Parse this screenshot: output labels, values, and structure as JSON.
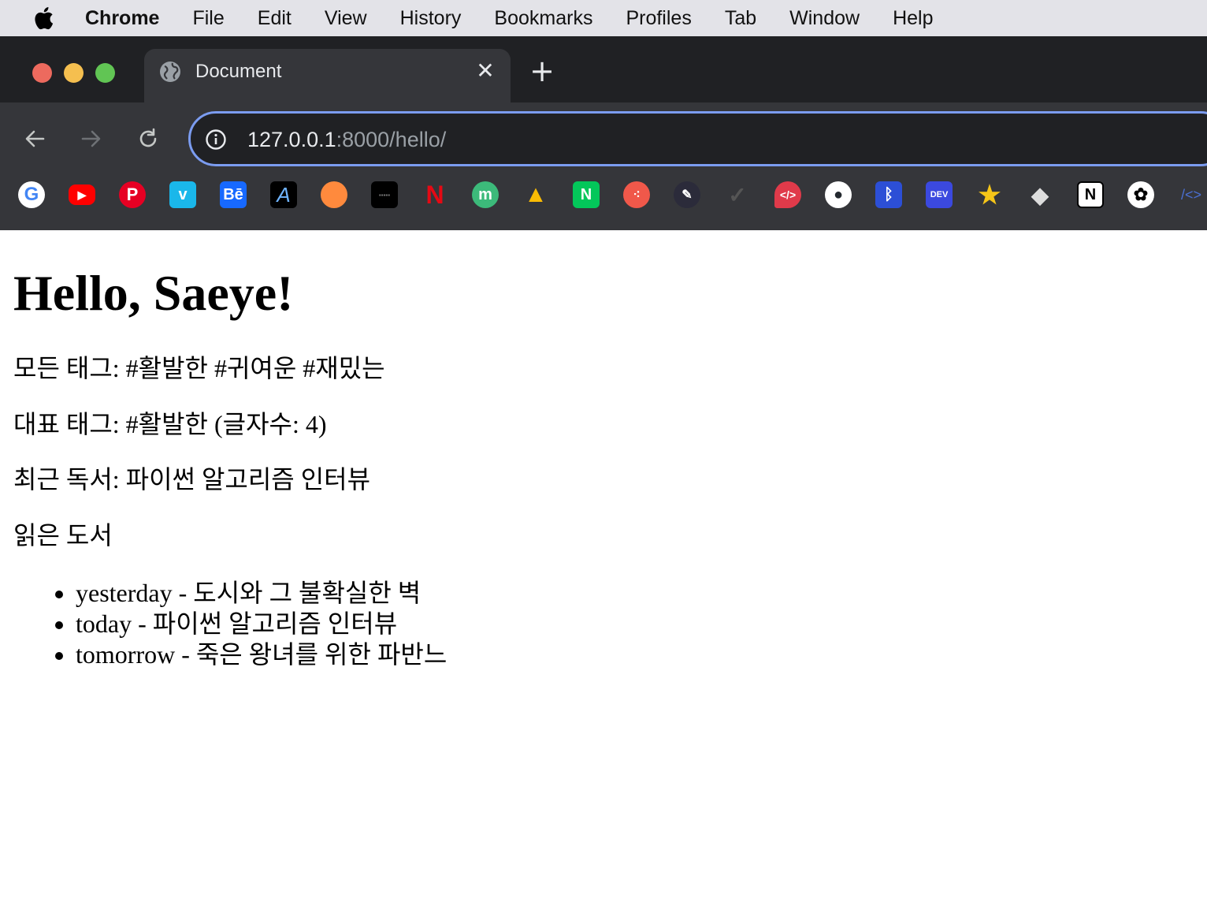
{
  "menubar": {
    "app_name": "Chrome",
    "items": [
      "File",
      "Edit",
      "View",
      "History",
      "Bookmarks",
      "Profiles",
      "Tab",
      "Window",
      "Help"
    ]
  },
  "browser": {
    "tab_title": "Document",
    "url_host": "127.0.0.1",
    "url_rest": ":8000/hello/",
    "bookmarks": [
      {
        "icon": "google-icon",
        "color": "#ffffff"
      },
      {
        "icon": "youtube-icon",
        "color": "#ff0000"
      },
      {
        "icon": "pinterest-icon",
        "color": "#e60023"
      },
      {
        "icon": "vimeo-icon",
        "color": "#1ab7ea",
        "text": "v"
      },
      {
        "icon": "behance-icon",
        "color": "#1769ff",
        "text": "Bē"
      },
      {
        "icon": "font-a-icon",
        "color": "#000000",
        "text": "A"
      },
      {
        "icon": "orange-icon",
        "color": "#ff8a3d"
      },
      {
        "icon": "black-box-icon",
        "color": "#000000"
      },
      {
        "icon": "netflix-icon",
        "color": "#e50914",
        "text": "N"
      },
      {
        "icon": "m-icon",
        "color": "#3cba7a",
        "text": "m"
      },
      {
        "icon": "google-drive-icon",
        "color": "#34a853"
      },
      {
        "icon": "naver-icon",
        "color": "#03c75a",
        "text": "N"
      },
      {
        "icon": "dots-icon",
        "color": "#f0584a"
      },
      {
        "icon": "pen-icon",
        "color": "#2b2b3a"
      },
      {
        "icon": "check-icon",
        "color": "#3a3a3a"
      },
      {
        "icon": "code-bubble-icon",
        "color": "#e03a4a"
      },
      {
        "icon": "github-icon",
        "color": "#ffffff"
      },
      {
        "icon": "bluetooth-icon",
        "color": "#2c4fd6"
      },
      {
        "icon": "dev-icon",
        "color": "#3b49df",
        "text": "DEV"
      },
      {
        "icon": "star-icon",
        "color": "#f5c518"
      },
      {
        "icon": "tag-icon",
        "color": "#dcdcdc"
      },
      {
        "icon": "notion-icon",
        "color": "#ffffff",
        "text": "N"
      },
      {
        "icon": "openai-icon",
        "color": "#ffffff"
      },
      {
        "icon": "code-brackets-icon",
        "color": "#4a6fd1",
        "text": "/<>"
      }
    ]
  },
  "page": {
    "heading": "Hello, Saeye!",
    "all_tags": "모든 태그: #활발한 #귀여운 #재밌는",
    "main_tag": "대표 태그: #활발한 (글자수: 4)",
    "recent_reading": "최근 독서: 파이썬 알고리즘 인터뷰",
    "books_heading": "읽은 도서",
    "books": [
      "yesterday - 도시와 그 불확실한 벽",
      "today - 파이썬 알고리즘 인터뷰",
      "tomorrow - 죽은 왕녀를 위한 파반느"
    ]
  }
}
